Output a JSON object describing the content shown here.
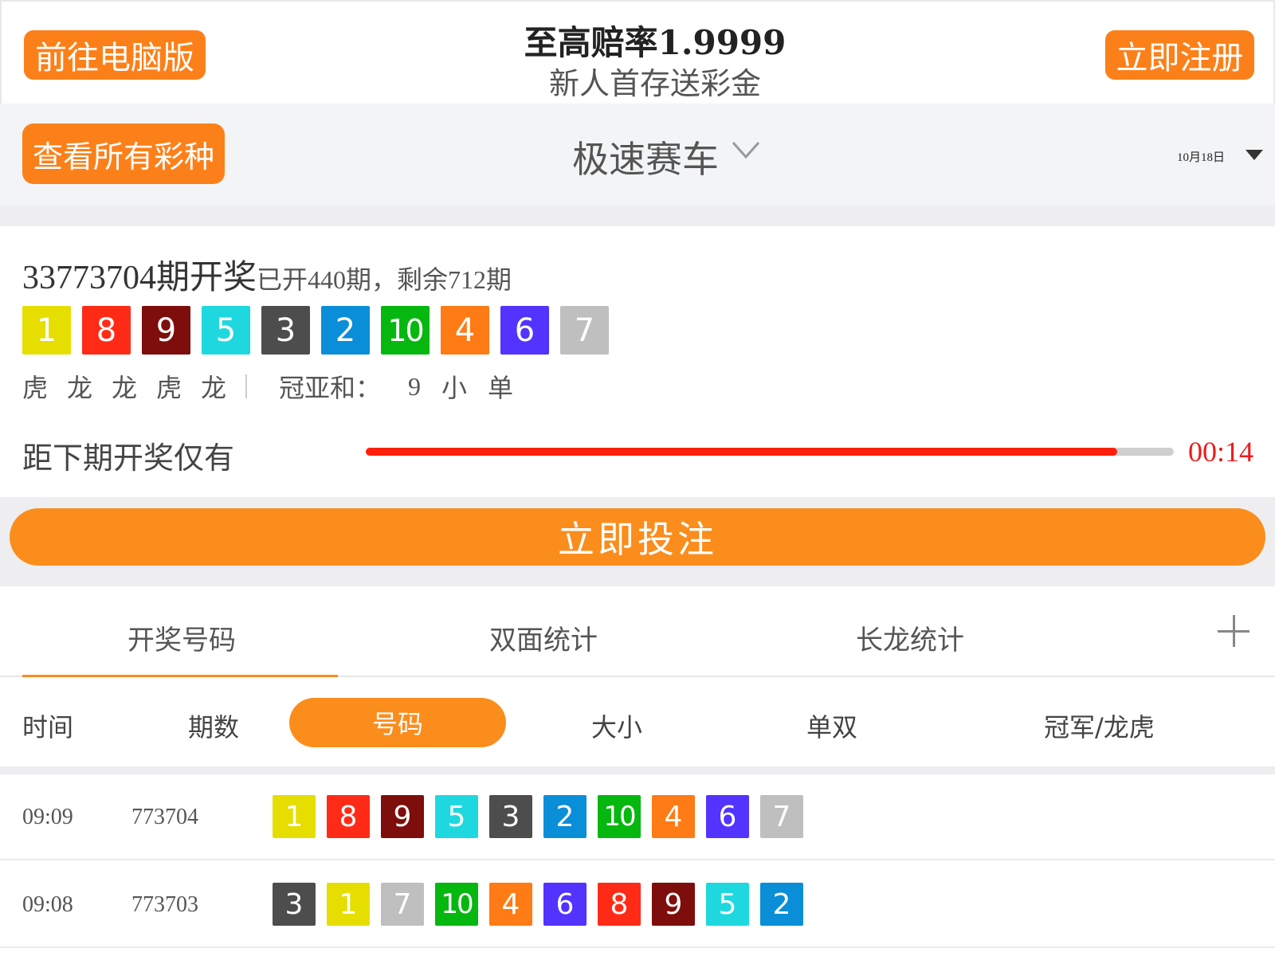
{
  "header": {
    "pc_button": "前往电脑版",
    "promo_title": "至高赔率1.9999",
    "promo_subtitle": "新人首存送彩金",
    "register_button": "立即注册"
  },
  "selector": {
    "all_games_button": "查看所有彩种",
    "game_name": "极速赛车",
    "date": "10月18日",
    "icons": [
      "chevron-down-icon",
      "caret-down-icon"
    ]
  },
  "current_draw": {
    "issue_title": "33773704期开奖",
    "issue_info": "已开440期，剩余712期",
    "numbers": [
      1,
      8,
      9,
      5,
      3,
      2,
      10,
      4,
      6,
      7
    ],
    "dragon_tiger": [
      "虎",
      "龙",
      "龙",
      "虎",
      "龙"
    ],
    "sum_label": "冠亚和：",
    "sum_value": "9",
    "sum_size": "小",
    "sum_parity": "单",
    "countdown_label": "距下期开奖仅有",
    "countdown_time": "00:14",
    "countdown_progress": 0.93
  },
  "bet_button": "立即投注",
  "tabs": [
    "开奖号码",
    "双面统计",
    "长龙统计"
  ],
  "tab_active_index": 0,
  "columns": {
    "time": "时间",
    "issue": "期数",
    "numbers": "号码",
    "size": "大小",
    "parity": "单双",
    "champion": "冠军/龙虎"
  },
  "ball_colors": {
    "1": "#e6de00",
    "2": "#0a8ed8",
    "3": "#4d4d4d",
    "4": "#ff7b15",
    "5": "#1fd8df",
    "6": "#5233ff",
    "7": "#bfbfbf",
    "8": "#ff2b17",
    "9": "#7d0e0b",
    "10": "#06b70f"
  },
  "results": [
    {
      "time": "09:09",
      "issue": "773704",
      "numbers": [
        1,
        8,
        9,
        5,
        3,
        2,
        10,
        4,
        6,
        7
      ]
    },
    {
      "time": "09:08",
      "issue": "773703",
      "numbers": [
        3,
        1,
        7,
        10,
        4,
        6,
        8,
        9,
        5,
        2
      ]
    }
  ]
}
